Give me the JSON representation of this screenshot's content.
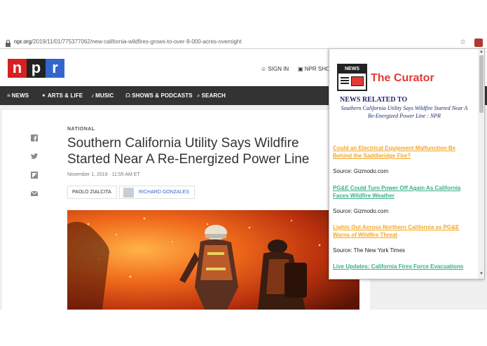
{
  "browser": {
    "url_host": "npr.org",
    "url_path": "/2019/11/01/775377062/new-california-wildfires-grows-to-over-8-000-acres-overnight",
    "star_icon": "star-icon",
    "extension_icon": "curator-extension-icon"
  },
  "npr": {
    "logo": [
      "n",
      "p",
      "r"
    ],
    "colors": {
      "n": "#d62021",
      "p": "#222222",
      "r": "#3266cc"
    },
    "sign_in": "SIGN IN",
    "shop": "NPR SHOP"
  },
  "nav": {
    "items": [
      {
        "icon": "≡",
        "label": "NEWS"
      },
      {
        "icon": "✶",
        "label": "ARTS & LIFE"
      },
      {
        "icon": "♪",
        "label": "MUSIC"
      },
      {
        "icon": "☊",
        "label": "SHOWS & PODCASTS"
      },
      {
        "icon": "⌕",
        "label": "SEARCH"
      }
    ]
  },
  "article": {
    "slug": "NATIONAL",
    "headline_line1": "Southern California Utility Says Wildfire",
    "headline_line2": "Started Near A Re-Energized Power Line",
    "date": "November 1, 2019 · 11:55 AM ET",
    "authors": [
      "PAOLO ZIALCITA",
      "RICHARD GONZALES"
    ],
    "share_icons": [
      "facebook-icon",
      "twitter-icon",
      "flipboard-icon",
      "email-icon"
    ]
  },
  "curator": {
    "logo_text": "NEWS",
    "title": "The Curator",
    "related_heading": "NEWS RELATED TO",
    "related_title": "Southern California Utility Says Wildfire Started Near A Re-Energized Power Line : NPR",
    "items": [
      {
        "title": "Could an Electrical Equipment Malfunction Be Behind the Saddleridge Fire?",
        "source": "Source: Gizmodo.com",
        "color": "#f5a623"
      },
      {
        "title": "PG&E Could Turn Power Off Again As California Faces Wildfire Weather",
        "source": "Source: Gizmodo.com",
        "color": "#3aaf85"
      },
      {
        "title": "Lights Out Across Northern California as PG&E Warns of Wildfire Threat",
        "source": "Source: The New York Times",
        "color": "#f5a623"
      },
      {
        "title": "Live Updates: California Fires Force Evacuations",
        "source": "",
        "color": "#3aaf85"
      }
    ]
  }
}
